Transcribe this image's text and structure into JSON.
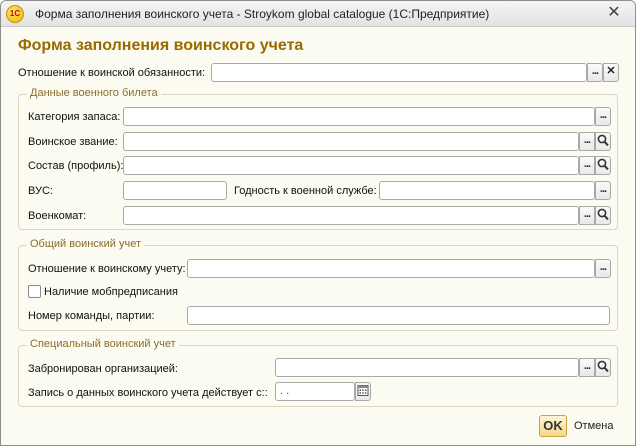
{
  "window": {
    "title": "Форма заполнения воинского учета - Stroykom global catalogue  (1С:Предприятие)",
    "logo_text": "1С",
    "close_icon": "close-icon"
  },
  "form": {
    "title": "Форма заполнения воинского учета",
    "relation_label": "Отношение к воинской обязанности:",
    "relation_value": ""
  },
  "military_ticket": {
    "title": "Данные военного билета",
    "reserve_category_label": "Категория запаса:",
    "rank_label": "Воинское звание:",
    "composition_label": "Состав (профиль):",
    "vus_label": "ВУС:",
    "fitness_label": "Годность к военной службе:",
    "commissariat_label": "Военкомат:",
    "reserve_category_value": "",
    "rank_value": "",
    "composition_value": "",
    "vus_value": "",
    "fitness_value": "",
    "commissariat_value": ""
  },
  "general": {
    "title": "Общий воинский учет",
    "relation_label": "Отношение к воинскому учету:",
    "mob_order_label": "Наличие мобпредписания",
    "team_number_label": "Номер команды, партии:",
    "relation_value": "",
    "team_number_value": "",
    "mob_order_checked": false
  },
  "special": {
    "title": "Специальный воинский учет",
    "reserved_label": "Забронирован организацией:",
    "record_date_label": "Запись о данных воинского учета действует с::",
    "reserved_value": "",
    "record_date_value": " .  ."
  },
  "buttons": {
    "ok_label": "OK",
    "cancel_label": "Отмена",
    "choose_glyph": "...",
    "clear_glyph": "✕"
  }
}
